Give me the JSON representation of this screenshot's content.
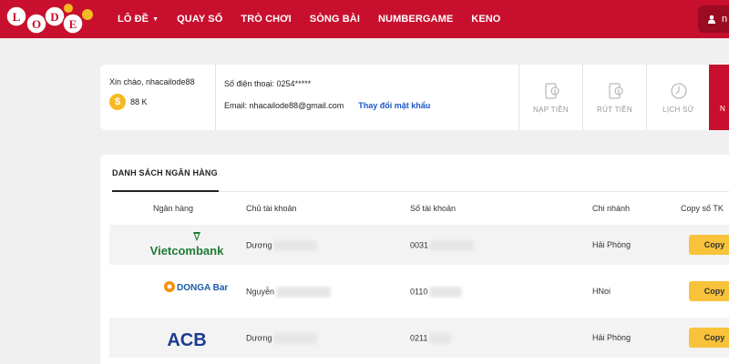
{
  "brand": {
    "logo_text": "LODE"
  },
  "nav": {
    "items": [
      {
        "label": "LÔ ĐỀ",
        "has_caret": true
      },
      {
        "label": "QUAY SỐ"
      },
      {
        "label": "TRÒ CHƠI"
      },
      {
        "label": "SÒNG BÀI"
      },
      {
        "label": "NUMBERGAME"
      },
      {
        "label": "KENO"
      }
    ]
  },
  "user_menu": {
    "label": "n"
  },
  "account": {
    "greeting": "Xin chào, nhacailode88",
    "balance": "88 K",
    "coin_symbol": "$",
    "phone": "Số điện thoại: 0254*****",
    "email": "Email: nhacailode88@gmail.com",
    "change_password": "Thay đổi mật khẩu",
    "actions": [
      {
        "label": "NẠP TIỀN",
        "icon": "deposit-icon"
      },
      {
        "label": "RÚT TIỀN",
        "icon": "withdraw-icon"
      },
      {
        "label": "LỊCH SỬ",
        "icon": "history-icon"
      }
    ],
    "red_tab_label": "N"
  },
  "banks": {
    "tab_label": "DANH SÁCH NGÂN HÀNG",
    "columns": [
      "Ngân hàng",
      "Chủ tài khoản",
      "Số tài khoản",
      "Chi nhánh",
      "Copy số TK"
    ],
    "rows": [
      {
        "bank": "Vietcombank",
        "owner": "Dương",
        "account": "0031",
        "branch": "Hải Phòng",
        "copy": "Copy"
      },
      {
        "bank": "DONGA Bank",
        "owner": "Nguyễn",
        "account": "0110",
        "branch": "HNoi",
        "copy": "Copy"
      },
      {
        "bank": "ACB",
        "owner": "Dương",
        "account": "0211",
        "branch": "Hải Phòng",
        "copy": "Copy"
      }
    ]
  },
  "colors": {
    "primary_red": "#c8102e",
    "copy_yellow": "#f8c23a",
    "coin_gold": "#f5b921",
    "link_blue": "#1a56c9"
  }
}
